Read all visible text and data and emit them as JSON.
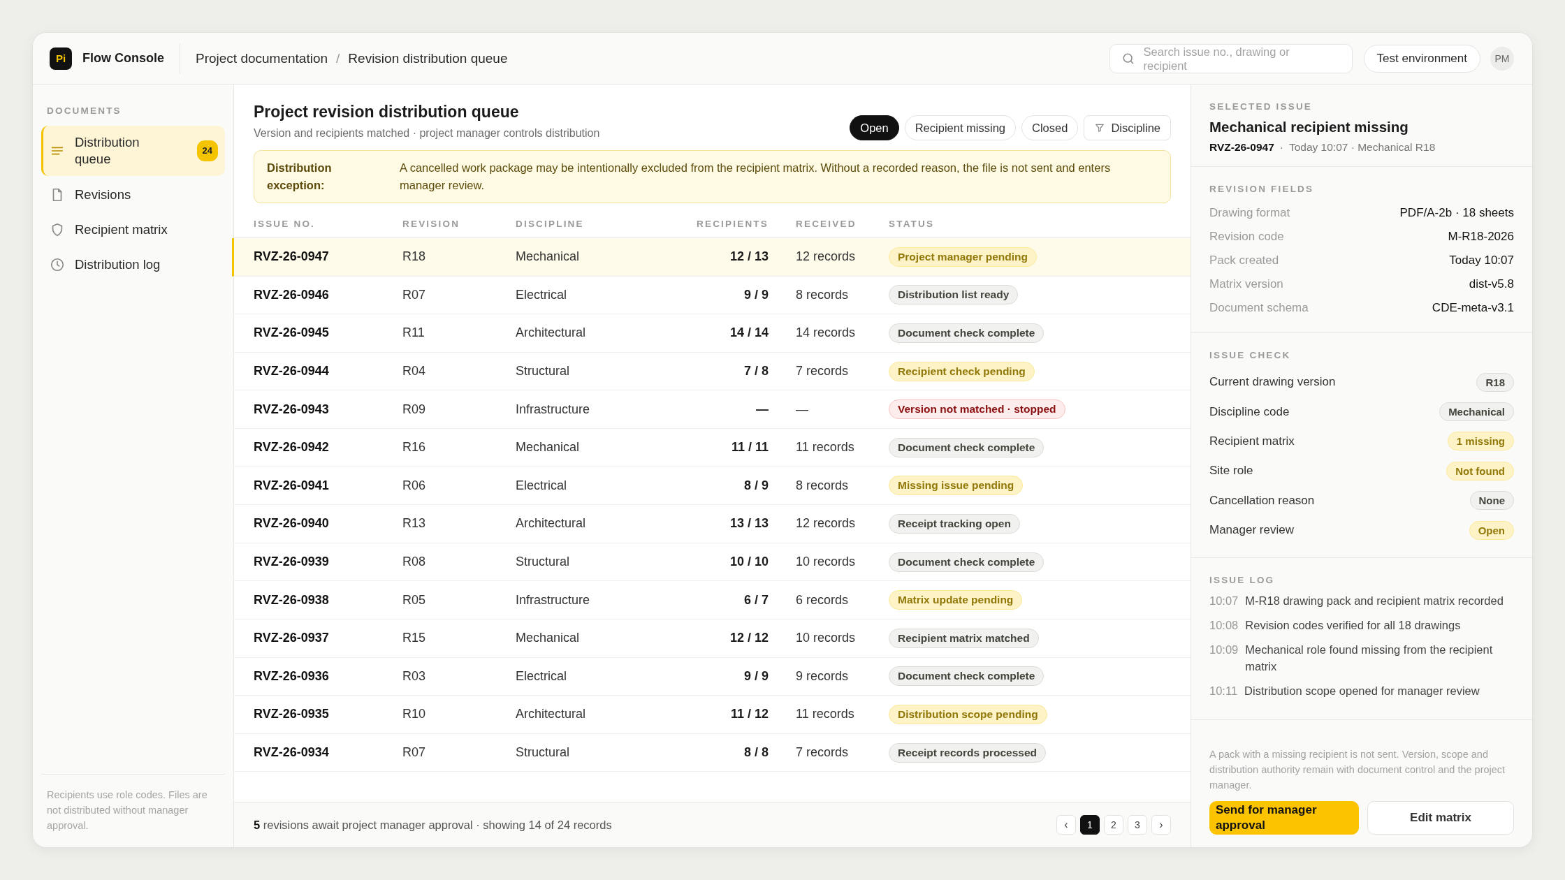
{
  "app": {
    "logo": "Pi",
    "name": "Flow Console"
  },
  "breadcrumb": {
    "items": [
      "Project documentation",
      "Revision distribution queue"
    ],
    "separator": "/"
  },
  "search": {
    "placeholder": "Search issue no., drawing or recipient"
  },
  "environment": "Test environment",
  "avatar": "PM",
  "sidebar": {
    "heading": "DOCUMENTS",
    "items": [
      {
        "label": "Distribution queue",
        "kind": "lines",
        "badge": "24",
        "selected": true
      },
      {
        "label": "Revisions",
        "kind": "document",
        "selected": false
      },
      {
        "label": "Recipient matrix",
        "kind": "shield",
        "selected": false
      },
      {
        "label": "Distribution log",
        "kind": "clock",
        "selected": false
      }
    ],
    "note": "Recipients use role codes. Files are not distributed without manager approval."
  },
  "queue": {
    "title": "Project revision distribution queue",
    "subtitle": "Version and recipients matched · project manager controls distribution",
    "filters": [
      {
        "label": "Open",
        "kind": "tab",
        "selected": true
      },
      {
        "label": "Recipient missing",
        "kind": "tab",
        "selected": false
      },
      {
        "label": "Closed",
        "kind": "tab",
        "selected": false
      },
      {
        "label": "Discipline",
        "kind": "dropdown",
        "selected": false
      }
    ],
    "alert": {
      "label": "Distribution exception:",
      "text": "A cancelled work package may be intentionally excluded from the recipient matrix. Without a recorded reason, the file is not sent and enters manager review."
    },
    "columns": [
      "ISSUE NO.",
      "REVISION",
      "DISCIPLINE",
      "RECIPIENTS",
      "RECEIVED",
      "STATUS"
    ],
    "rows": [
      {
        "issue": "RVZ-26-0947",
        "revision": "R18",
        "discipline": "Mechanical",
        "recipients": "12 / 13",
        "received": "12 records",
        "status": "Project manager pending",
        "color": "#fdf3c6",
        "selected": true
      },
      {
        "issue": "RVZ-26-0946",
        "revision": "R07",
        "discipline": "Electrical",
        "recipients": "9 / 9",
        "received": "8 records",
        "status": "Distribution list ready",
        "color": "#f1f1ef",
        "selected": false
      },
      {
        "issue": "RVZ-26-0945",
        "revision": "R11",
        "discipline": "Architectural",
        "recipients": "14 / 14",
        "received": "14 records",
        "status": "Document check complete",
        "color": "#f1f1ef",
        "selected": false
      },
      {
        "issue": "RVZ-26-0944",
        "revision": "R04",
        "discipline": "Structural",
        "recipients": "7 / 8",
        "received": "7 records",
        "status": "Recipient check pending",
        "color": "#fdf3c6",
        "selected": false
      },
      {
        "issue": "RVZ-26-0943",
        "revision": "R09",
        "discipline": "Infrastructure",
        "recipients": "—",
        "received": "—",
        "status": "Version not matched · stopped",
        "color": "#fdecec",
        "selected": false
      },
      {
        "issue": "RVZ-26-0942",
        "revision": "R16",
        "discipline": "Mechanical",
        "recipients": "11 / 11",
        "received": "11 records",
        "status": "Document check complete",
        "color": "#f1f1ef",
        "selected": false
      },
      {
        "issue": "RVZ-26-0941",
        "revision": "R06",
        "discipline": "Electrical",
        "recipients": "8 / 9",
        "received": "8 records",
        "status": "Missing issue pending",
        "color": "#fdf3c6",
        "selected": false
      },
      {
        "issue": "RVZ-26-0940",
        "revision": "R13",
        "discipline": "Architectural",
        "recipients": "13 / 13",
        "received": "12 records",
        "status": "Receipt tracking open",
        "color": "#f1f1ef",
        "selected": false
      },
      {
        "issue": "RVZ-26-0939",
        "revision": "R08",
        "discipline": "Structural",
        "recipients": "10 / 10",
        "received": "10 records",
        "status": "Document check complete",
        "color": "#f1f1ef",
        "selected": false
      },
      {
        "issue": "RVZ-26-0938",
        "revision": "R05",
        "discipline": "Infrastructure",
        "recipients": "6 / 7",
        "received": "6 records",
        "status": "Matrix update pending",
        "color": "#fdf3c6",
        "selected": false
      },
      {
        "issue": "RVZ-26-0937",
        "revision": "R15",
        "discipline": "Mechanical",
        "recipients": "12 / 12",
        "received": "10 records",
        "status": "Recipient matrix matched",
        "color": "#f1f1ef",
        "selected": false
      },
      {
        "issue": "RVZ-26-0936",
        "revision": "R03",
        "discipline": "Electrical",
        "recipients": "9 / 9",
        "received": "9 records",
        "status": "Document check complete",
        "color": "#f1f1ef",
        "selected": false
      },
      {
        "issue": "RVZ-26-0935",
        "revision": "R10",
        "discipline": "Architectural",
        "recipients": "11 / 12",
        "received": "11 records",
        "status": "Distribution scope pending",
        "color": "#fdf3c6",
        "selected": false
      },
      {
        "issue": "RVZ-26-0934",
        "revision": "R07",
        "discipline": "Structural",
        "recipients": "8 / 8",
        "received": "7 records",
        "status": "Receipt records processed",
        "color": "#f1f1ef",
        "selected": false
      }
    ],
    "summary": "**5** revisions await project manager approval · showing 14 of 24 records",
    "pages": [
      {
        "label": "‹",
        "kind": "arrow",
        "selected": false
      },
      {
        "label": "1",
        "kind": "number",
        "selected": true
      },
      {
        "label": "2",
        "kind": "number",
        "selected": false
      },
      {
        "label": "3",
        "kind": "number",
        "selected": false
      },
      {
        "label": "›",
        "kind": "arrow",
        "selected": false
      }
    ]
  },
  "detail": {
    "selected_issue": {
      "heading": "SELECTED ISSUE",
      "title": "Mechanical recipient missing",
      "issue": "RVZ-26-0947",
      "separator": "·",
      "meta": "Today 10:07 · Mechanical R18"
    },
    "revision_fields": {
      "heading": "REVISION FIELDS",
      "items": [
        {
          "label": "Drawing format",
          "value": "PDF/A-2b · 18 sheets"
        },
        {
          "label": "Revision code",
          "value": "M-R18-2026"
        },
        {
          "label": "Pack created",
          "value": "Today 10:07"
        },
        {
          "label": "Matrix version",
          "value": "dist-v5.8"
        },
        {
          "label": "Document schema",
          "value": "CDE-meta-v3.1"
        }
      ]
    },
    "issue_check": {
      "heading": "ISSUE CHECK",
      "items": [
        {
          "label": "Current drawing version",
          "value": "R18",
          "color": "#f1f1ef"
        },
        {
          "label": "Discipline code",
          "value": "Mechanical",
          "color": "#f1f1ef"
        },
        {
          "label": "Recipient matrix",
          "value": "1 missing",
          "color": "#fdf3c6"
        },
        {
          "label": "Site role",
          "value": "Not found",
          "color": "#fdf3c6"
        },
        {
          "label": "Cancellation reason",
          "value": "None",
          "color": "#f1f1ef"
        },
        {
          "label": "Manager review",
          "value": "Open",
          "color": "#fdf3c6"
        }
      ]
    },
    "issue_log": {
      "heading": "ISSUE LOG",
      "items": [
        {
          "time": "10:07",
          "text": "M-R18 drawing pack and recipient matrix recorded"
        },
        {
          "time": "10:08",
          "text": "Revision codes verified for all 18 drawings"
        },
        {
          "time": "10:09",
          "text": "Mechanical role found missing from the recipient matrix"
        },
        {
          "time": "10:11",
          "text": "Distribution scope opened for manager review"
        }
      ]
    },
    "note": "A pack with a missing recipient is not sent. Version, scope and distribution authority remain with document control and the project manager.",
    "actions": [
      {
        "label": "Send for manager approval",
        "kind": "primary"
      },
      {
        "label": "Edit matrix",
        "kind": "secondary"
      }
    ]
  }
}
